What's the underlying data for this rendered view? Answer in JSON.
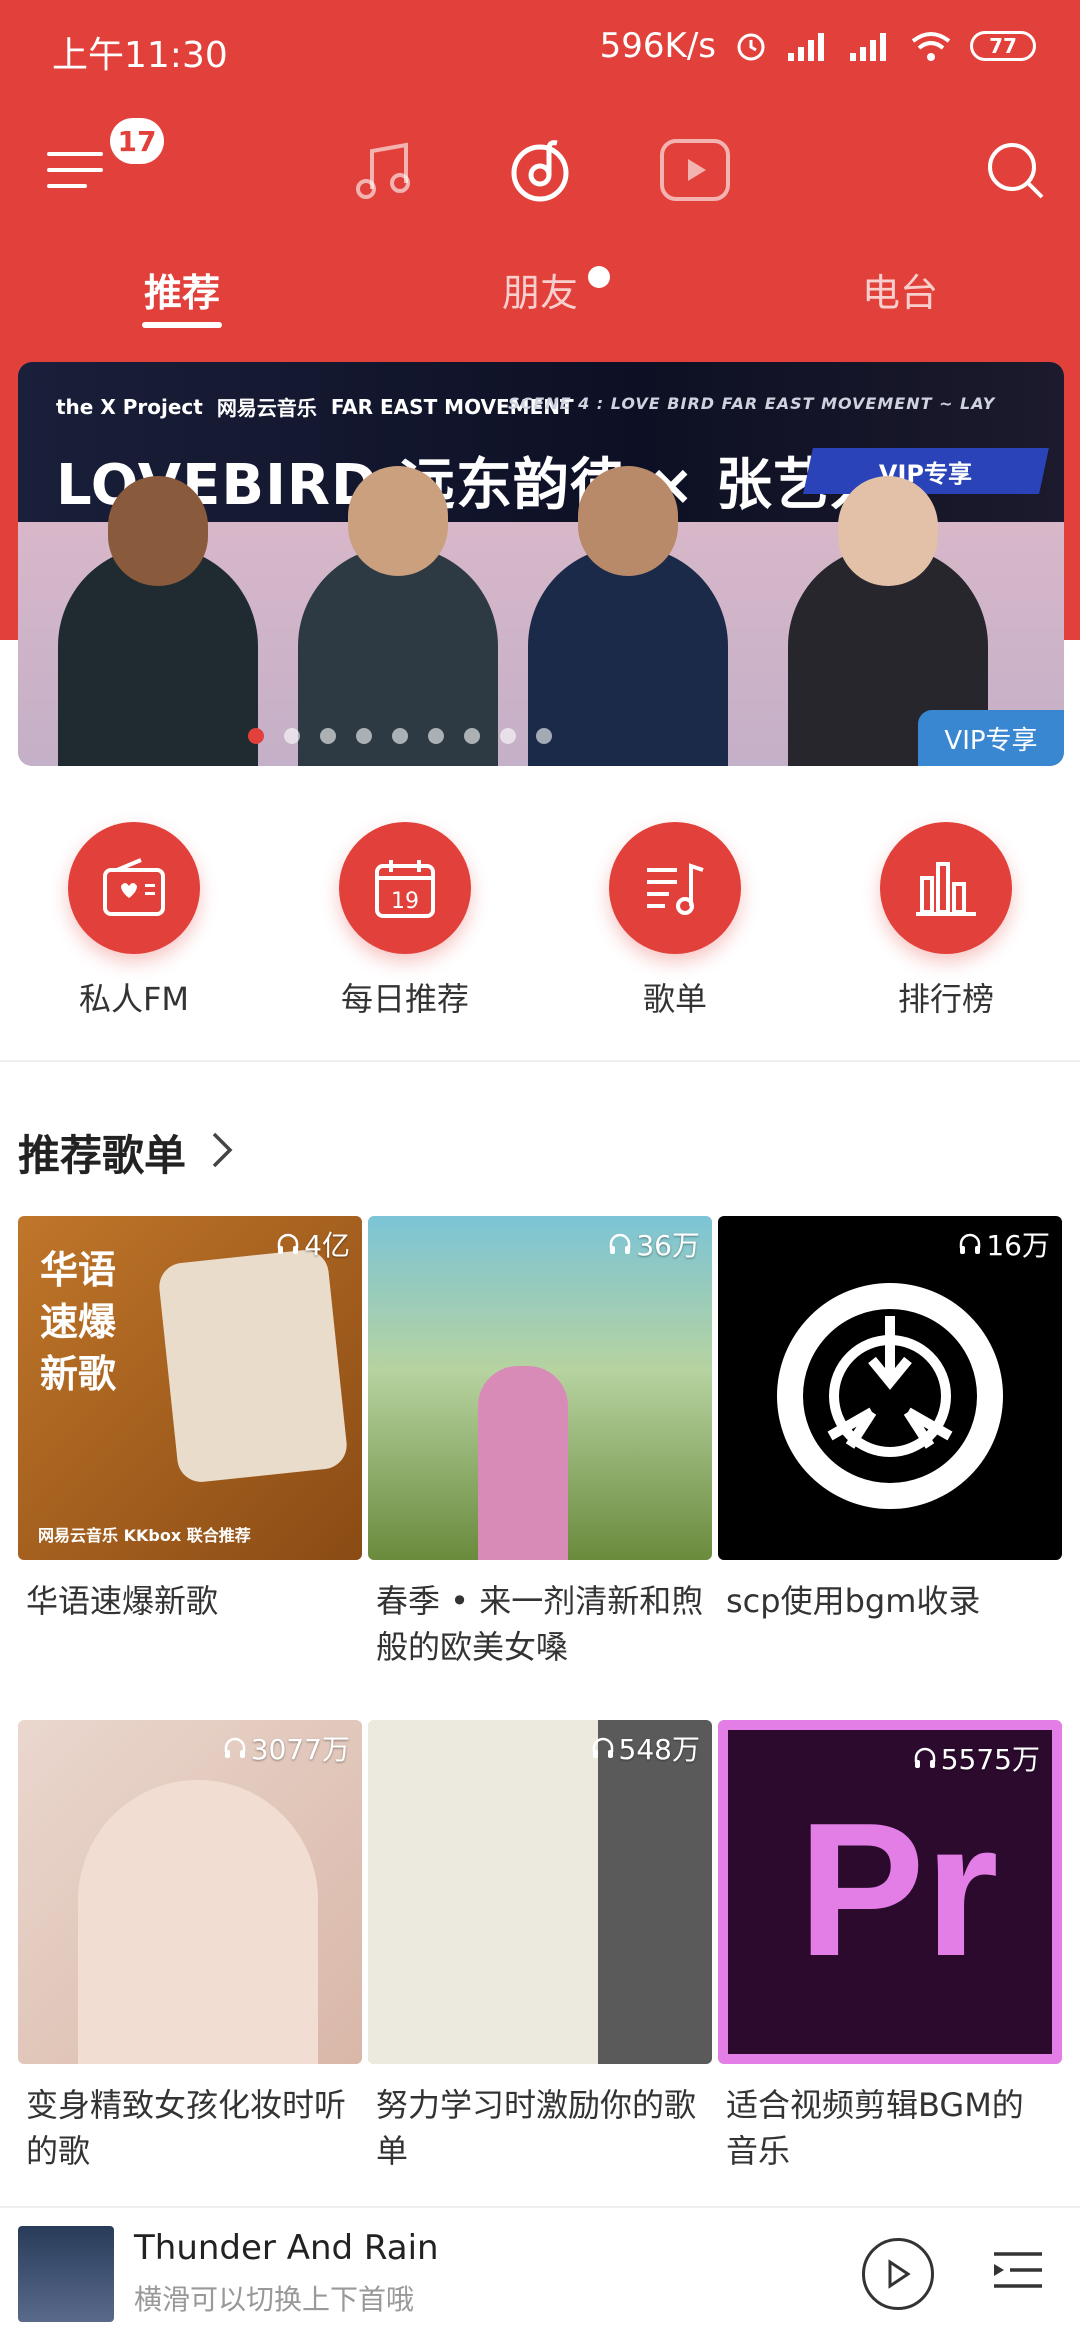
{
  "status": {
    "time": "上午11:30",
    "speed": "596K/s",
    "battery": "77"
  },
  "nav": {
    "menu_badge": "17"
  },
  "tabs": [
    {
      "label": "推荐"
    },
    {
      "label": "朋友"
    },
    {
      "label": "电台"
    }
  ],
  "banner": {
    "brand_project": "the X Project",
    "brand_app": "网易云音乐",
    "brand_artist": "FAR EAST MOVEMENT",
    "scene": "SCENE 4 : LOVE BIRD   FAR EAST MOVEMENT ~ LAY",
    "title": "LOVEBIRD 远东韵律 × 张艺兴",
    "vip_tag": "VIP专享",
    "corner_tag": "VIP专享",
    "dots_total": 9,
    "dots_active": 1
  },
  "quick": [
    {
      "label": "私人FM",
      "icon": "radio-icon"
    },
    {
      "label": "每日推荐",
      "icon": "calendar-icon",
      "day": "19"
    },
    {
      "label": "歌单",
      "icon": "playlist-icon"
    },
    {
      "label": "排行榜",
      "icon": "chart-icon"
    }
  ],
  "section": {
    "title": "推荐歌单"
  },
  "playlists": [
    {
      "title": "华语速爆新歌",
      "plays": "4亿",
      "cover_text": "华语\n速爆\n新歌",
      "cover_sub": "网易云音乐 KKbox 联合推荐",
      "color": "#b5651d"
    },
    {
      "title": "春季 • 来一剂清新和煦般的欧美女嗓",
      "plays": "36万",
      "color": "#6fb8c9"
    },
    {
      "title": "scp使用bgm收录",
      "plays": "16万",
      "color": "#000000"
    },
    {
      "title": "变身精致女孩化妆时听的歌",
      "plays": "3077万",
      "color": "#e8cfc4"
    },
    {
      "title": "努力学习时激励你的歌单",
      "plays": "548万",
      "color": "#d7d4cc"
    },
    {
      "title": "适合视频剪辑BGM的音乐",
      "plays": "5575万",
      "cover_text": "Pr",
      "color": "#2b0a2e"
    }
  ],
  "player": {
    "song": "Thunder And Rain",
    "hint": "横滑可以切换上下首哦"
  }
}
